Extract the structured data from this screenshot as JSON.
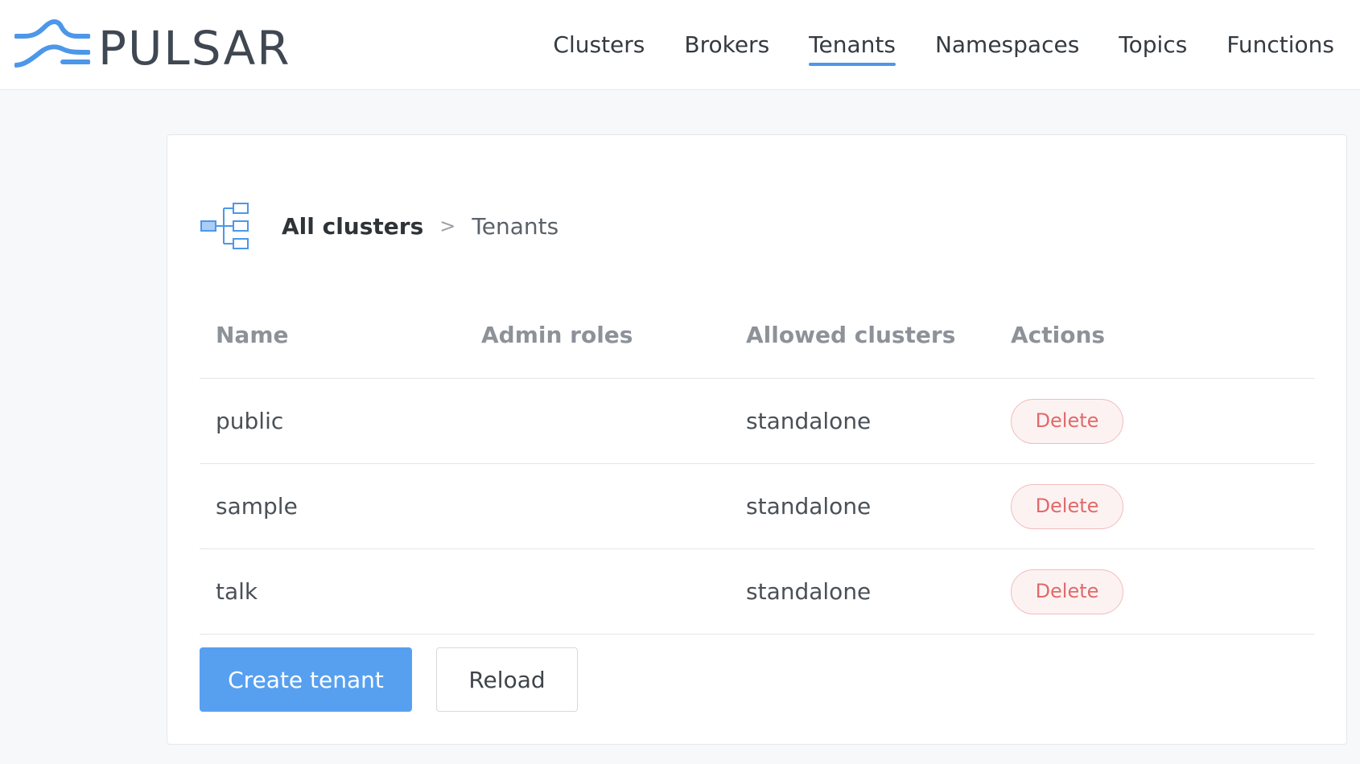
{
  "app": {
    "logo_text": "PULSAR"
  },
  "nav": {
    "items": [
      {
        "label": "Clusters",
        "active": false
      },
      {
        "label": "Brokers",
        "active": false
      },
      {
        "label": "Tenants",
        "active": true
      },
      {
        "label": "Namespaces",
        "active": false
      },
      {
        "label": "Topics",
        "active": false
      },
      {
        "label": "Functions",
        "active": false
      }
    ]
  },
  "breadcrumb": {
    "icon": "tree-structure-icon",
    "root": "All clusters",
    "separator": ">",
    "current": "Tenants"
  },
  "table": {
    "headers": [
      "Name",
      "Admin roles",
      "Allowed clusters",
      "Actions"
    ],
    "rows": [
      {
        "name": "public",
        "admin_roles": "",
        "allowed_clusters": "standalone",
        "action": "Delete"
      },
      {
        "name": "sample",
        "admin_roles": "",
        "allowed_clusters": "standalone",
        "action": "Delete"
      },
      {
        "name": "talk",
        "admin_roles": "",
        "allowed_clusters": "standalone",
        "action": "Delete"
      }
    ]
  },
  "buttons": {
    "create": "Create tenant",
    "reload": "Reload"
  },
  "colors": {
    "accent": "#4c97ea",
    "primary_button": "#57a0f0",
    "danger_text": "#e06a6a",
    "danger_border": "#f2bcbc"
  }
}
